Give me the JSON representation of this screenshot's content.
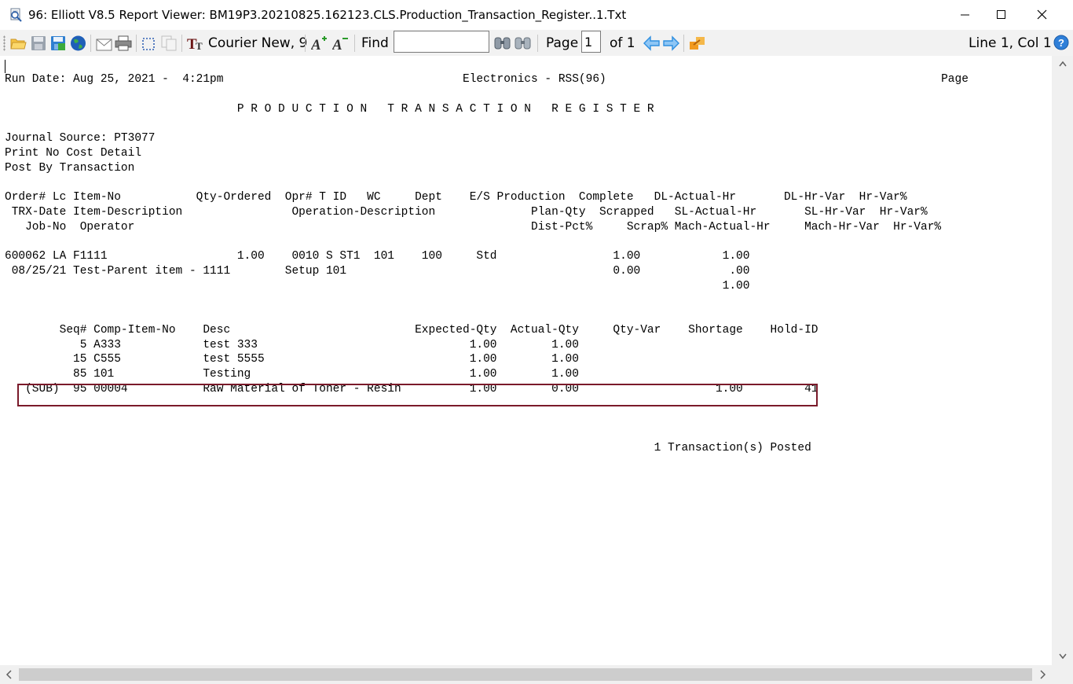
{
  "window": {
    "title": "96: Elliott V8.5 Report Viewer: BM19P3.20210825.162123.CLS.Production_Transaction_Register..1.Txt"
  },
  "toolbar": {
    "font_label": "Courier New, 9",
    "find_label": "Find",
    "find_value": "",
    "page_label": "Page",
    "page_value": "1",
    "of_label": "of 1",
    "status": "Line 1, Col 1"
  },
  "icons": {
    "open": "folder-open-icon",
    "save": "save-icon",
    "save_as": "save-as-icon",
    "web": "globe-icon",
    "email": "email-icon",
    "print": "print-icon",
    "select": "select-all-icon",
    "copy": "copy-icon",
    "font": "font-icon",
    "grow": "font-grow-icon",
    "shrink": "font-shrink-icon",
    "find_next": "binoculars-icon",
    "find_prev": "binoculars-back-icon",
    "prev": "arrow-left-icon",
    "next": "arrow-right-icon",
    "export": "export-icon",
    "help": "help-icon"
  },
  "colors": {
    "highlight": "#7a1a2a",
    "arrow_blue": "#2f8fe0"
  },
  "report": {
    "lines": [
      "Run Date: Aug 25, 2021 -  4:21pm                                   Electronics - RSS(96)                                                 Page",
      "",
      "                                  P R O D U C T I O N   T R A N S A C T I O N   R E G I S T E R",
      "",
      "Journal Source: PT3077",
      "Print No Cost Detail",
      "Post By Transaction",
      "",
      "Order# Lc Item-No           Qty-Ordered  Opr# T ID   WC     Dept    E/S Production  Complete   DL-Actual-Hr       DL-Hr-Var  Hr-Var%",
      " TRX-Date Item-Description                Operation-Description              Plan-Qty  Scrapped   SL-Actual-Hr       SL-Hr-Var  Hr-Var%",
      "   Job-No  Operator                                                          Dist-Pct%     Scrap% Mach-Actual-Hr     Mach-Hr-Var  Hr-Var%",
      "",
      "600062 LA F1111                   1.00    0010 S ST1  101    100     Std                 1.00            1.00",
      " 08/25/21 Test-Parent item - 1111        Setup 101                                       0.00             .00",
      "                                                                                                         1.00",
      "",
      "",
      "        Seq# Comp-Item-No    Desc                           Expected-Qty  Actual-Qty     Qty-Var    Shortage    Hold-ID",
      "           5 A333            test 333                               1.00        1.00",
      "          15 C555            test 5555                              1.00        1.00",
      "          85 101             Testing                                1.00        1.00",
      "   (SUB)  95 00004           Raw Material of Toner - Resin          1.00        0.00                    1.00         41",
      "",
      "",
      "",
      "                                                                                               1 Transaction(s) Posted"
    ]
  }
}
